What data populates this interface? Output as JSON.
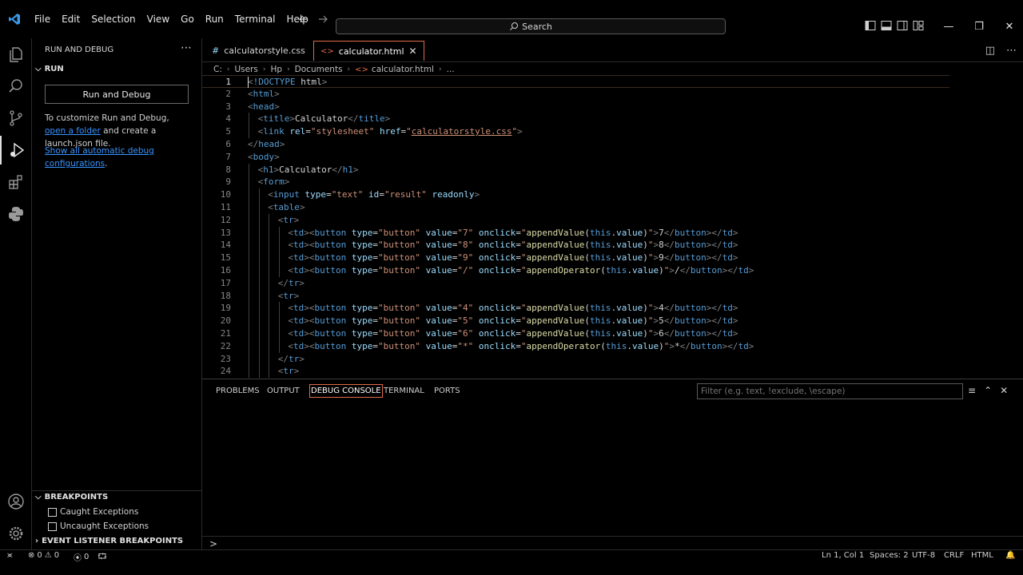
{
  "menu": [
    "File",
    "Edit",
    "Selection",
    "View",
    "Go",
    "Run",
    "Terminal",
    "Help"
  ],
  "search": {
    "label": "Search"
  },
  "sidebar": {
    "title": "RUN AND DEBUG",
    "run_section": "RUN",
    "run_button": "Run and Debug",
    "customize_text_1": "To customize Run and Debug, ",
    "open_folder_link": "open a folder",
    "customize_text_2": " and create a launch.json file.",
    "show_configs_link": "Show all automatic debug configurations",
    "show_configs_end": ".",
    "breakpoints_section": "BREAKPOINTS",
    "breakpoints": [
      "Caught Exceptions",
      "Uncaught Exceptions"
    ],
    "event_listener_section": "EVENT LISTENER BREAKPOINTS"
  },
  "tabs": [
    {
      "label": "calculatorstyle.css",
      "icon": "css-hash-icon"
    },
    {
      "label": "calculator.html",
      "icon": "html-brackets-icon",
      "active": true
    }
  ],
  "breadcrumb": [
    "C:",
    "Users",
    "Hp",
    "Documents",
    "calculator.html",
    "..."
  ],
  "code_lines": [
    {
      "n": "1",
      "i": 0,
      "c": [
        [
          "t",
          "<"
        ],
        [
          "tn",
          "!DOCTYPE"
        ],
        [
          "tx",
          " html"
        ],
        [
          "t",
          ">"
        ]
      ]
    },
    {
      "n": "2",
      "i": 0,
      "c": [
        [
          "t",
          "<"
        ],
        [
          "tn",
          "html"
        ],
        [
          "t",
          ">"
        ]
      ]
    },
    {
      "n": "3",
      "i": 0,
      "c": [
        [
          "t",
          "<"
        ],
        [
          "tn",
          "head"
        ],
        [
          "t",
          ">"
        ]
      ]
    },
    {
      "n": "4",
      "i": 1,
      "c": [
        [
          "t",
          "<"
        ],
        [
          "tn",
          "title"
        ],
        [
          "t",
          ">"
        ],
        [
          "tx",
          "Calculator"
        ],
        [
          "t",
          "</"
        ],
        [
          "tn",
          "title"
        ],
        [
          "t",
          ">"
        ]
      ]
    },
    {
      "n": "5",
      "i": 1,
      "c": [
        [
          "t",
          "<"
        ],
        [
          "tn",
          "link"
        ],
        [
          "an",
          " rel"
        ],
        [
          "tx",
          "="
        ],
        [
          "av",
          "\"stylesheet\""
        ],
        [
          "an",
          " href"
        ],
        [
          "tx",
          "="
        ],
        [
          "av",
          "\""
        ],
        [
          "av ul",
          "calculatorstyle.css"
        ],
        [
          "av",
          "\""
        ],
        [
          "t",
          ">"
        ]
      ]
    },
    {
      "n": "6",
      "i": 0,
      "c": [
        [
          "t",
          "</"
        ],
        [
          "tn",
          "head"
        ],
        [
          "t",
          ">"
        ]
      ]
    },
    {
      "n": "7",
      "i": 0,
      "c": [
        [
          "t",
          "<"
        ],
        [
          "tn",
          "body"
        ],
        [
          "t",
          ">"
        ]
      ]
    },
    {
      "n": "8",
      "i": 1,
      "c": [
        [
          "t",
          "<"
        ],
        [
          "tn",
          "h1"
        ],
        [
          "t",
          ">"
        ],
        [
          "tx",
          "Calculator"
        ],
        [
          "t",
          "</"
        ],
        [
          "tn",
          "h1"
        ],
        [
          "t",
          ">"
        ]
      ]
    },
    {
      "n": "9",
      "i": 1,
      "c": [
        [
          "t",
          "<"
        ],
        [
          "tn",
          "form"
        ],
        [
          "t",
          ">"
        ]
      ]
    },
    {
      "n": "10",
      "i": 2,
      "c": [
        [
          "t",
          "<"
        ],
        [
          "tn",
          "input"
        ],
        [
          "an",
          " type"
        ],
        [
          "tx",
          "="
        ],
        [
          "av",
          "\"text\""
        ],
        [
          "an",
          " id"
        ],
        [
          "tx",
          "="
        ],
        [
          "av",
          "\"result\""
        ],
        [
          "an",
          " readonly"
        ],
        [
          "t",
          ">"
        ]
      ]
    },
    {
      "n": "11",
      "i": 2,
      "c": [
        [
          "t",
          "<"
        ],
        [
          "tn",
          "table"
        ],
        [
          "t",
          ">"
        ]
      ]
    },
    {
      "n": "12",
      "i": 3,
      "c": [
        [
          "t",
          "<"
        ],
        [
          "tn",
          "tr"
        ],
        [
          "t",
          ">"
        ]
      ]
    },
    {
      "n": "13",
      "i": 4,
      "c": [
        [
          "t",
          "<"
        ],
        [
          "tn",
          "td"
        ],
        [
          "t",
          "><"
        ],
        [
          "tn",
          "button"
        ],
        [
          "an",
          " type"
        ],
        [
          "tx",
          "="
        ],
        [
          "av",
          "\"button\""
        ],
        [
          "an",
          " value"
        ],
        [
          "tx",
          "="
        ],
        [
          "av",
          "\"7\""
        ],
        [
          "an",
          " onclick"
        ],
        [
          "tx",
          "="
        ],
        [
          "av",
          "\""
        ],
        [
          "fn",
          "appendValue"
        ],
        [
          "tx",
          "("
        ],
        [
          "kw",
          "this"
        ],
        [
          "tx",
          "."
        ],
        [
          "an",
          "value"
        ],
        [
          "tx",
          ")"
        ],
        [
          "av",
          "\""
        ],
        [
          "t",
          ">"
        ],
        [
          "tx",
          "7"
        ],
        [
          "t",
          "</"
        ],
        [
          "tn",
          "button"
        ],
        [
          "t",
          "></"
        ],
        [
          "tn",
          "td"
        ],
        [
          "t",
          ">"
        ]
      ]
    },
    {
      "n": "14",
      "i": 4,
      "c": [
        [
          "t",
          "<"
        ],
        [
          "tn",
          "td"
        ],
        [
          "t",
          "><"
        ],
        [
          "tn",
          "button"
        ],
        [
          "an",
          " type"
        ],
        [
          "tx",
          "="
        ],
        [
          "av",
          "\"button\""
        ],
        [
          "an",
          " value"
        ],
        [
          "tx",
          "="
        ],
        [
          "av",
          "\"8\""
        ],
        [
          "an",
          " onclick"
        ],
        [
          "tx",
          "="
        ],
        [
          "av",
          "\""
        ],
        [
          "fn",
          "appendValue"
        ],
        [
          "tx",
          "("
        ],
        [
          "kw",
          "this"
        ],
        [
          "tx",
          "."
        ],
        [
          "an",
          "value"
        ],
        [
          "tx",
          ")"
        ],
        [
          "av",
          "\""
        ],
        [
          "t",
          ">"
        ],
        [
          "tx",
          "8"
        ],
        [
          "t",
          "</"
        ],
        [
          "tn",
          "button"
        ],
        [
          "t",
          "></"
        ],
        [
          "tn",
          "td"
        ],
        [
          "t",
          ">"
        ]
      ]
    },
    {
      "n": "15",
      "i": 4,
      "c": [
        [
          "t",
          "<"
        ],
        [
          "tn",
          "td"
        ],
        [
          "t",
          "><"
        ],
        [
          "tn",
          "button"
        ],
        [
          "an",
          " type"
        ],
        [
          "tx",
          "="
        ],
        [
          "av",
          "\"button\""
        ],
        [
          "an",
          " value"
        ],
        [
          "tx",
          "="
        ],
        [
          "av",
          "\"9\""
        ],
        [
          "an",
          " onclick"
        ],
        [
          "tx",
          "="
        ],
        [
          "av",
          "\""
        ],
        [
          "fn",
          "appendValue"
        ],
        [
          "tx",
          "("
        ],
        [
          "kw",
          "this"
        ],
        [
          "tx",
          "."
        ],
        [
          "an",
          "value"
        ],
        [
          "tx",
          ")"
        ],
        [
          "av",
          "\""
        ],
        [
          "t",
          ">"
        ],
        [
          "tx",
          "9"
        ],
        [
          "t",
          "</"
        ],
        [
          "tn",
          "button"
        ],
        [
          "t",
          "></"
        ],
        [
          "tn",
          "td"
        ],
        [
          "t",
          ">"
        ]
      ]
    },
    {
      "n": "16",
      "i": 4,
      "c": [
        [
          "t",
          "<"
        ],
        [
          "tn",
          "td"
        ],
        [
          "t",
          "><"
        ],
        [
          "tn",
          "button"
        ],
        [
          "an",
          " type"
        ],
        [
          "tx",
          "="
        ],
        [
          "av",
          "\"button\""
        ],
        [
          "an",
          " value"
        ],
        [
          "tx",
          "="
        ],
        [
          "av",
          "\"/\""
        ],
        [
          "an",
          " onclick"
        ],
        [
          "tx",
          "="
        ],
        [
          "av",
          "\""
        ],
        [
          "fn",
          "appendOperator"
        ],
        [
          "tx",
          "("
        ],
        [
          "kw",
          "this"
        ],
        [
          "tx",
          "."
        ],
        [
          "an",
          "value"
        ],
        [
          "tx",
          ")"
        ],
        [
          "av",
          "\""
        ],
        [
          "t",
          ">"
        ],
        [
          "tx",
          "/"
        ],
        [
          "t",
          "</"
        ],
        [
          "tn",
          "button"
        ],
        [
          "t",
          "></"
        ],
        [
          "tn",
          "td"
        ],
        [
          "t",
          ">"
        ]
      ]
    },
    {
      "n": "17",
      "i": 3,
      "c": [
        [
          "t",
          "</"
        ],
        [
          "tn",
          "tr"
        ],
        [
          "t",
          ">"
        ]
      ]
    },
    {
      "n": "18",
      "i": 3,
      "c": [
        [
          "t",
          "<"
        ],
        [
          "tn",
          "tr"
        ],
        [
          "t",
          ">"
        ]
      ]
    },
    {
      "n": "19",
      "i": 4,
      "c": [
        [
          "t",
          "<"
        ],
        [
          "tn",
          "td"
        ],
        [
          "t",
          "><"
        ],
        [
          "tn",
          "button"
        ],
        [
          "an",
          " type"
        ],
        [
          "tx",
          "="
        ],
        [
          "av",
          "\"button\""
        ],
        [
          "an",
          " value"
        ],
        [
          "tx",
          "="
        ],
        [
          "av",
          "\"4\""
        ],
        [
          "an",
          " onclick"
        ],
        [
          "tx",
          "="
        ],
        [
          "av",
          "\""
        ],
        [
          "fn",
          "appendValue"
        ],
        [
          "tx",
          "("
        ],
        [
          "kw",
          "this"
        ],
        [
          "tx",
          "."
        ],
        [
          "an",
          "value"
        ],
        [
          "tx",
          ")"
        ],
        [
          "av",
          "\""
        ],
        [
          "t",
          ">"
        ],
        [
          "tx",
          "4"
        ],
        [
          "t",
          "</"
        ],
        [
          "tn",
          "button"
        ],
        [
          "t",
          "></"
        ],
        [
          "tn",
          "td"
        ],
        [
          "t",
          ">"
        ]
      ]
    },
    {
      "n": "20",
      "i": 4,
      "c": [
        [
          "t",
          "<"
        ],
        [
          "tn",
          "td"
        ],
        [
          "t",
          "><"
        ],
        [
          "tn",
          "button"
        ],
        [
          "an",
          " type"
        ],
        [
          "tx",
          "="
        ],
        [
          "av",
          "\"button\""
        ],
        [
          "an",
          " value"
        ],
        [
          "tx",
          "="
        ],
        [
          "av",
          "\"5\""
        ],
        [
          "an",
          " onclick"
        ],
        [
          "tx",
          "="
        ],
        [
          "av",
          "\""
        ],
        [
          "fn",
          "appendValue"
        ],
        [
          "tx",
          "("
        ],
        [
          "kw",
          "this"
        ],
        [
          "tx",
          "."
        ],
        [
          "an",
          "value"
        ],
        [
          "tx",
          ")"
        ],
        [
          "av",
          "\""
        ],
        [
          "t",
          ">"
        ],
        [
          "tx",
          "5"
        ],
        [
          "t",
          "</"
        ],
        [
          "tn",
          "button"
        ],
        [
          "t",
          "></"
        ],
        [
          "tn",
          "td"
        ],
        [
          "t",
          ">"
        ]
      ]
    },
    {
      "n": "21",
      "i": 4,
      "c": [
        [
          "t",
          "<"
        ],
        [
          "tn",
          "td"
        ],
        [
          "t",
          "><"
        ],
        [
          "tn",
          "button"
        ],
        [
          "an",
          " type"
        ],
        [
          "tx",
          "="
        ],
        [
          "av",
          "\"button\""
        ],
        [
          "an",
          " value"
        ],
        [
          "tx",
          "="
        ],
        [
          "av",
          "\"6\""
        ],
        [
          "an",
          " onclick"
        ],
        [
          "tx",
          "="
        ],
        [
          "av",
          "\""
        ],
        [
          "fn",
          "appendValue"
        ],
        [
          "tx",
          "("
        ],
        [
          "kw",
          "this"
        ],
        [
          "tx",
          "."
        ],
        [
          "an",
          "value"
        ],
        [
          "tx",
          ")"
        ],
        [
          "av",
          "\""
        ],
        [
          "t",
          ">"
        ],
        [
          "tx",
          "6"
        ],
        [
          "t",
          "</"
        ],
        [
          "tn",
          "button"
        ],
        [
          "t",
          "></"
        ],
        [
          "tn",
          "td"
        ],
        [
          "t",
          ">"
        ]
      ]
    },
    {
      "n": "22",
      "i": 4,
      "c": [
        [
          "t",
          "<"
        ],
        [
          "tn",
          "td"
        ],
        [
          "t",
          "><"
        ],
        [
          "tn",
          "button"
        ],
        [
          "an",
          " type"
        ],
        [
          "tx",
          "="
        ],
        [
          "av",
          "\"button\""
        ],
        [
          "an",
          " value"
        ],
        [
          "tx",
          "="
        ],
        [
          "av",
          "\"*\""
        ],
        [
          "an",
          " onclick"
        ],
        [
          "tx",
          "="
        ],
        [
          "av",
          "\""
        ],
        [
          "fn",
          "appendOperator"
        ],
        [
          "tx",
          "("
        ],
        [
          "kw",
          "this"
        ],
        [
          "tx",
          "."
        ],
        [
          "an",
          "value"
        ],
        [
          "tx",
          ")"
        ],
        [
          "av",
          "\""
        ],
        [
          "t",
          ">"
        ],
        [
          "tx",
          "*"
        ],
        [
          "t",
          "</"
        ],
        [
          "tn",
          "button"
        ],
        [
          "t",
          "></"
        ],
        [
          "tn",
          "td"
        ],
        [
          "t",
          ">"
        ]
      ]
    },
    {
      "n": "23",
      "i": 3,
      "c": [
        [
          "t",
          "</"
        ],
        [
          "tn",
          "tr"
        ],
        [
          "t",
          ">"
        ]
      ]
    },
    {
      "n": "24",
      "i": 3,
      "c": [
        [
          "t",
          "<"
        ],
        [
          "tn",
          "tr"
        ],
        [
          "t",
          ">"
        ]
      ]
    }
  ],
  "panel": {
    "tabs": [
      "PROBLEMS",
      "OUTPUT",
      "DEBUG CONSOLE",
      "TERMINAL",
      "PORTS"
    ],
    "active_tab": "DEBUG CONSOLE",
    "filter_placeholder": "Filter (e.g. text, !exclude, \\escape)",
    "prompt": ">"
  },
  "statusbar": {
    "errors": "0",
    "warnings": "0",
    "ports": "0",
    "position": "Ln 1, Col 1",
    "spaces": "Spaces: 2",
    "encoding": "UTF-8",
    "eol": "CRLF",
    "language": "HTML"
  },
  "colors": {
    "accent": "#e06c4a",
    "link": "#3794ff",
    "tag": "#569cd6",
    "attr_name": "#9cdcfe",
    "attr_value": "#ce9178",
    "function": "#dcdcaa",
    "bracket": "#808080"
  }
}
